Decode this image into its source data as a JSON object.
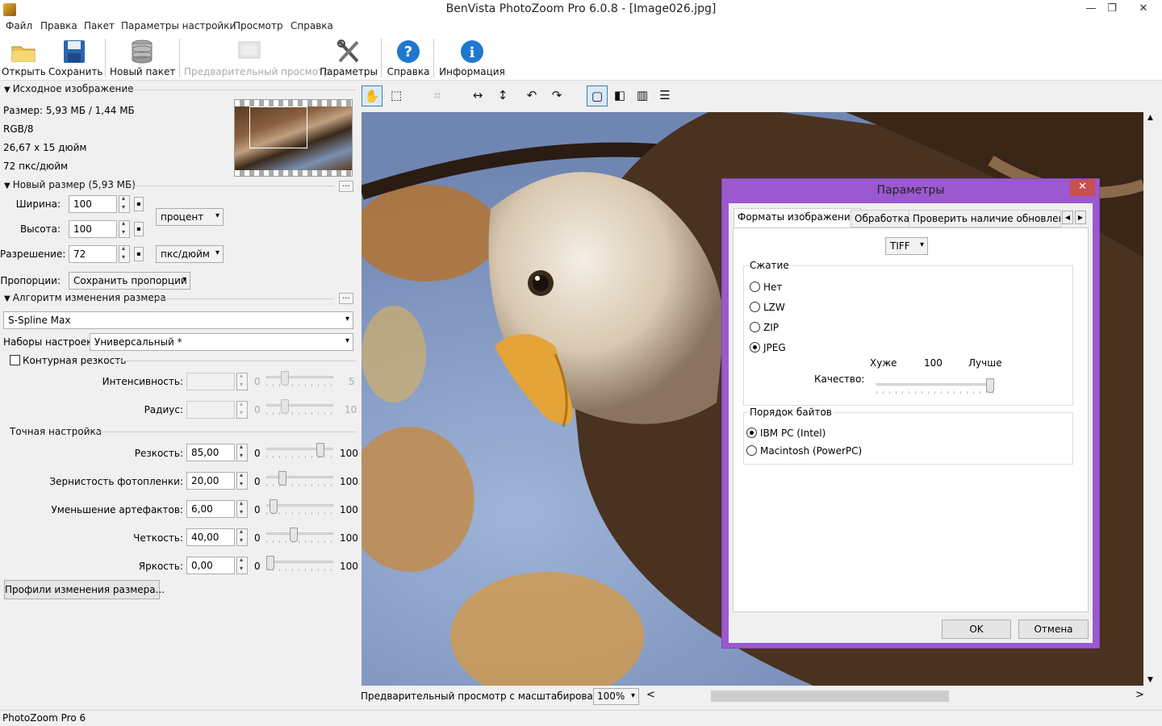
{
  "window": {
    "title": "BenVista PhotoZoom Pro 6.0.8 - [Image026.jpg]",
    "minimize": "—",
    "restore": "❐",
    "close": "✕"
  },
  "menu": [
    "Файл",
    "Правка",
    "Пакет",
    "Параметры настройки",
    "Просмотр",
    "Справка"
  ],
  "toolbar": {
    "open": "Открыть",
    "save": "Сохранить",
    "batch": "Новый пакет",
    "preview": "Предварительный просмотр",
    "settings": "Параметры",
    "help": "Справка",
    "info": "Информация"
  },
  "source": {
    "header": "Исходное изображение",
    "size": "Размер: 5,93 МБ / 1,44 МБ",
    "mode": "RGB/8",
    "dims": "26,67 x 15 дюйм",
    "res": "72 пкс/дюйм"
  },
  "newsize": {
    "header": "Новый размер (5,93 МБ)",
    "width_label": "Ширина:",
    "width": "100",
    "height_label": "Высота:",
    "height": "100",
    "unit": "процент",
    "res_label": "Разрешение:",
    "res": "72",
    "res_unit": "пкс/дюйм",
    "prop_label": "Пропорции:",
    "prop": "Сохранить пропорции",
    "dots": "..."
  },
  "algo": {
    "header": "Алгоритм изменения размера",
    "method": "S-Spline Max",
    "presets_label": "Наборы настроек:",
    "preset": "Универсальный *",
    "unsharp": "Контурная резкость",
    "intensity_label": "Интенсивность:",
    "intensity_min": "0",
    "intensity_max": "5",
    "intensity_level": 0.25,
    "radius_label": "Радиус:",
    "radius_min": "0",
    "radius_max": "10",
    "radius_level": 0.25
  },
  "fine": {
    "header": "Точная настройка",
    "rows": [
      {
        "label": "Резкость:",
        "value": "85,00",
        "min": "0",
        "max": "100",
        "level": 0.85
      },
      {
        "label": "Зернистость фотопленки:",
        "value": "20,00",
        "min": "0",
        "max": "100",
        "level": 0.2
      },
      {
        "label": "Уменьшение артефактов:",
        "value": "6,00",
        "min": "0",
        "max": "100",
        "level": 0.06
      },
      {
        "label": "Четкость:",
        "value": "40,00",
        "min": "0",
        "max": "100",
        "level": 0.4
      },
      {
        "label": "Яркость:",
        "value": "0,00",
        "min": "0",
        "max": "100",
        "level": 0.0
      }
    ],
    "profiles_button": "Профили изменения размера..."
  },
  "preview_bar": {
    "label": "Предварительный просмотр с масштабированием:",
    "zoom": "100%",
    "left": "<",
    "right": ">"
  },
  "status": "PhotoZoom Pro 6",
  "dialog": {
    "title": "Параметры",
    "close": "✕",
    "tabs": [
      "Форматы изображений",
      "Обработка",
      "Проверить наличие обновлений"
    ],
    "format": "TIFF",
    "compression_title": "Сжатие",
    "compression": [
      {
        "label": "Нет",
        "selected": false
      },
      {
        "label": "LZW",
        "selected": false
      },
      {
        "label": "ZIP",
        "selected": false
      },
      {
        "label": "JPEG",
        "selected": true
      }
    ],
    "quality_label": "Качество:",
    "quality_worse": "Хуже",
    "quality_value": "100",
    "quality_better": "Лучше",
    "quality_level": 1.0,
    "byteorder_title": "Порядок байтов",
    "byteorder": [
      {
        "label": "IBM PC (Intel)",
        "selected": true
      },
      {
        "label": "Macintosh (PowerPC)",
        "selected": false
      }
    ],
    "ok": "OK",
    "cancel": "Отмена"
  },
  "colors": {
    "dialog_frame": "#9b59d0",
    "close_red": "#c75050",
    "accent_blue": "#3c7fb1"
  }
}
